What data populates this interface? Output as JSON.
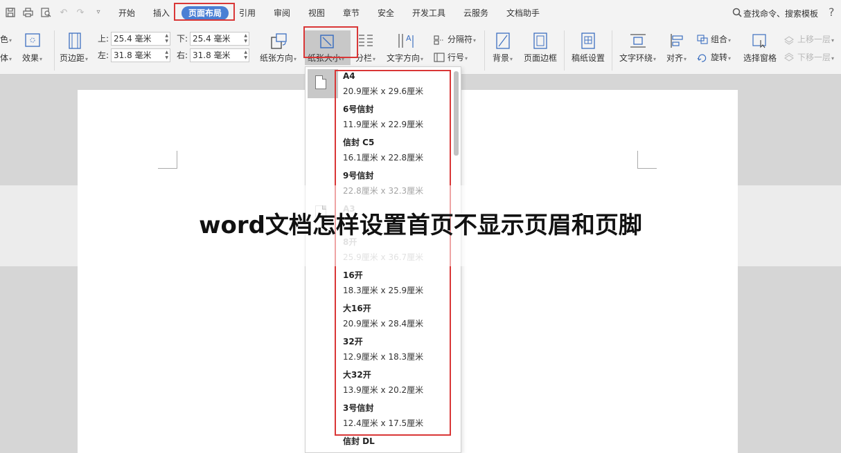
{
  "quick_access": {
    "icons": [
      "save-icon",
      "print-icon",
      "print-preview-icon",
      "undo-icon",
      "redo-icon",
      "customize-icon"
    ]
  },
  "menu": {
    "tabs": [
      "开始",
      "插入",
      "页面布局",
      "引用",
      "审阅",
      "视图",
      "章节",
      "安全",
      "开发工具",
      "云服务",
      "文档助手"
    ],
    "active_tab": "页面布局",
    "search_label": "查找命令、搜索模板",
    "help_label": "?"
  },
  "ribbon": {
    "color_label": "色",
    "font_label": "体",
    "effects_label": "效果",
    "margins_label": "页边距",
    "margin_top_label": "上:",
    "margin_top_value": "25.4 毫米",
    "margin_bottom_label": "下:",
    "margin_bottom_value": "25.4 毫米",
    "margin_left_label": "左:",
    "margin_left_value": "31.8 毫米",
    "margin_right_label": "右:",
    "margin_right_value": "31.8 毫米",
    "orientation_label": "纸张方向",
    "paper_size_label": "纸张大小",
    "columns_label": "分栏",
    "text_direction_label": "文字方向",
    "breaks_label": "分隔符",
    "line_numbers_label": "行号",
    "background_label": "背景",
    "page_border_label": "页面边框",
    "manuscript_label": "稿纸设置",
    "text_wrap_label": "文字环绕",
    "align_label": "对齐",
    "group_label": "组合",
    "rotate_label": "旋转",
    "selection_pane_label": "选择窗格",
    "bring_forward_label": "上移一层",
    "send_backward_label": "下移一层"
  },
  "document": {
    "title": "word文档怎样设置首页不显示页眉和页脚"
  },
  "paper_sizes": [
    {
      "name": "A4",
      "dims": "20.9厘米  x  29.6厘米"
    },
    {
      "name": "6号信封",
      "dims": "11.9厘米  x  22.9厘米"
    },
    {
      "name": "信封 C5",
      "dims": "16.1厘米  x  22.8厘米"
    },
    {
      "name": "9号信封",
      "dims": "22.8厘米  x  32.3厘米"
    },
    {
      "name": "A3",
      "dims": ""
    },
    {
      "name": "8开",
      "dims": "25.9厘米  x  36.7厘米"
    },
    {
      "name": "16开",
      "dims": "18.3厘米  x  25.9厘米"
    },
    {
      "name": "大16开",
      "dims": "20.9厘米  x  28.4厘米"
    },
    {
      "name": "32开",
      "dims": "12.9厘米  x  18.3厘米"
    },
    {
      "name": "大32开",
      "dims": "13.9厘米  x  20.2厘米"
    },
    {
      "name": "3号信封",
      "dims": "12.4厘米  x  17.5厘米"
    },
    {
      "name": "信封 DL",
      "dims": ""
    }
  ],
  "colors": {
    "accent": "#4a7fd4",
    "highlight": "#d93636"
  }
}
